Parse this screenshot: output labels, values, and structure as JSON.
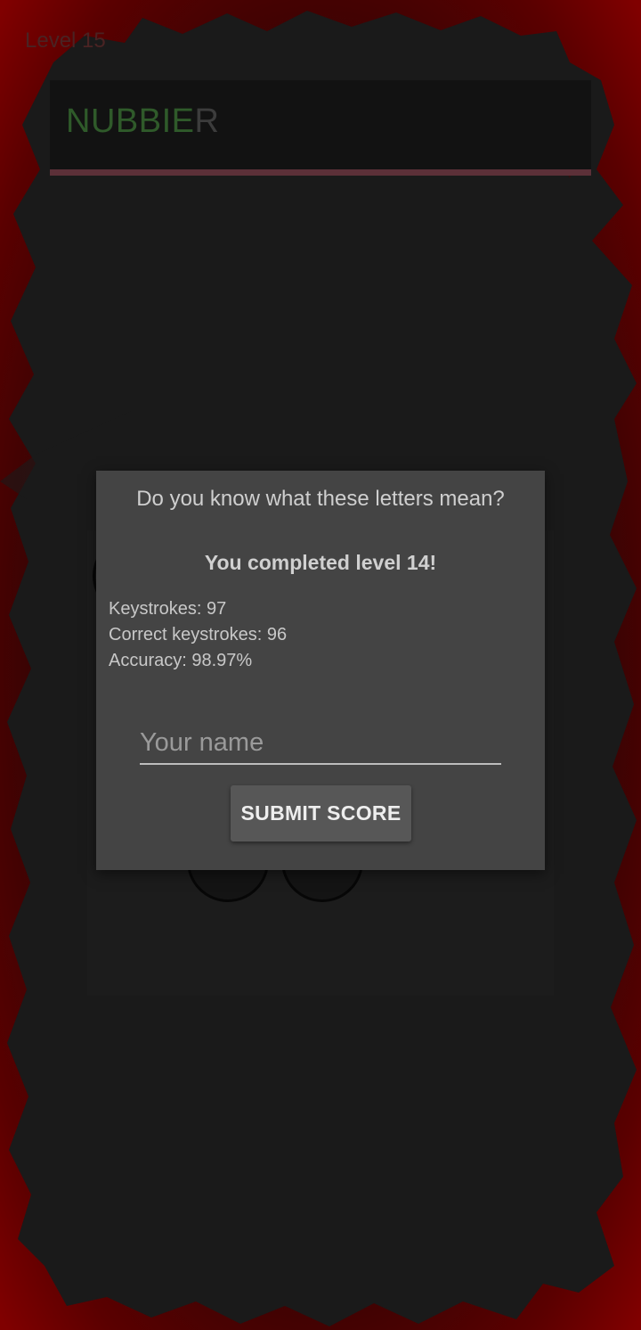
{
  "header": {
    "level_label": "Level 15",
    "word_typed": "NUBBIE",
    "word_remaining": "R"
  },
  "dialog": {
    "title": "Do you know what these letters mean?",
    "completed_text": "You completed level 14!",
    "stats": {
      "keystrokes": "Keystrokes: 97",
      "correct_keystrokes": "Correct keystrokes: 96",
      "accuracy": "Accuracy: 98.97%"
    },
    "name_placeholder": "Your name",
    "name_value": "",
    "submit_label": "SUBMIT SCORE"
  },
  "colors": {
    "frame_red": "#7a0000",
    "typed_letters": "#2f5a2a",
    "dialog_bg": "#444444"
  }
}
